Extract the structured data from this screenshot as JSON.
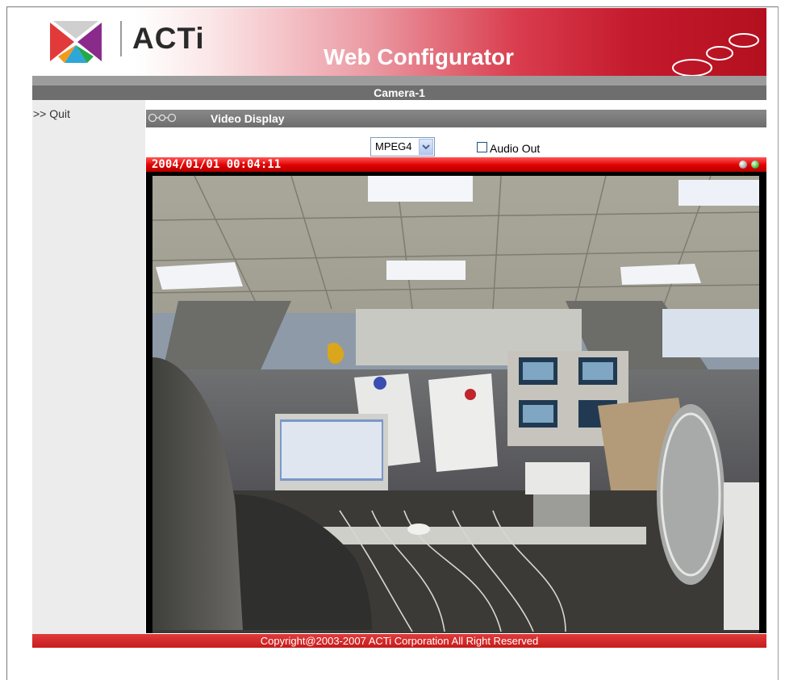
{
  "header": {
    "logo_text": "ACTi",
    "title": "Web Configurator"
  },
  "camera": {
    "name": "Camera-1"
  },
  "sidebar": {
    "quit_label": ">> Quit"
  },
  "section": {
    "title": "Video Display"
  },
  "controls": {
    "codec_selected": "MPEG4",
    "audio_out_label": "Audio Out",
    "audio_out_checked": false
  },
  "video": {
    "timestamp": "2004/01/01 00:04:11"
  },
  "footer": {
    "copyright": "Copyright@2003-2007 ACTi Corporation All Right Reserved"
  },
  "colors": {
    "brand_red": "#c41a2d",
    "bar_gray": "#6e6e6e",
    "video_bar_red": "#e00000"
  },
  "icons": {
    "logo": "acti-logo-icon",
    "section": "rings-icon",
    "dropdown": "chevron-down-icon"
  }
}
